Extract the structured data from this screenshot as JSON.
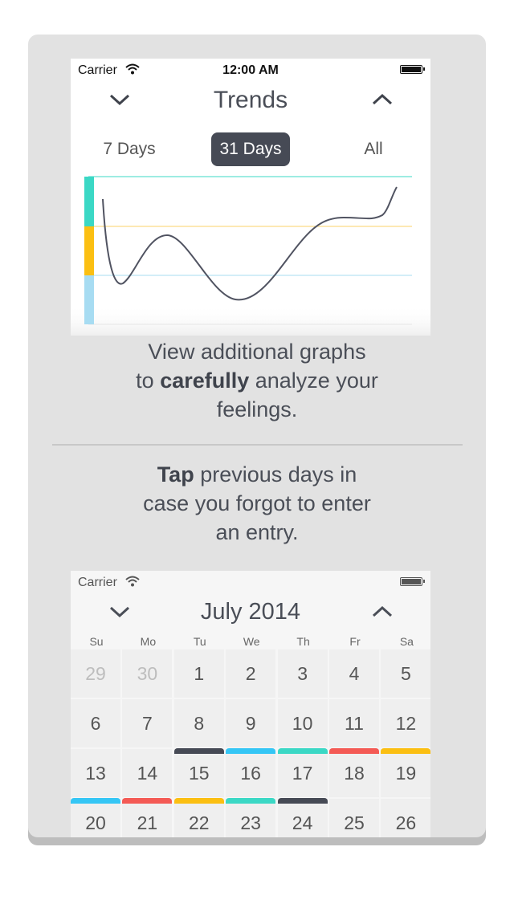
{
  "top": {
    "status": {
      "carrier": "Carrier",
      "time": "12:00 AM"
    },
    "nav_title": "Trends",
    "segments": [
      "7 Days",
      "31 Days",
      "All"
    ],
    "active_segment": 1
  },
  "caption1": {
    "before": "View additional graphs\nto ",
    "bold": "carefully",
    "after": " analyze your feelings."
  },
  "caption2": {
    "bold": "Tap",
    "after": " previous days in case you forgot to enter an entry."
  },
  "calendar": {
    "carrier": "Carrier",
    "title": "July 2014",
    "weekday_labels": [
      "Su",
      "Mo",
      "Tu",
      "We",
      "Th",
      "Fr",
      "Sa"
    ],
    "weeks": [
      [
        "29",
        "30",
        "1",
        "2",
        "3",
        "4",
        "5"
      ],
      [
        "6",
        "7",
        "8",
        "9",
        "10",
        "11",
        "12"
      ],
      [
        "13",
        "14",
        "15",
        "16",
        "17",
        "18",
        "19"
      ],
      [
        "20",
        "21",
        "22",
        "23",
        "24",
        "25",
        "26"
      ]
    ],
    "muted": [
      "29",
      "30"
    ],
    "markers": {
      "15": "#464a55",
      "16": "#35c6f5",
      "17": "#3bd8c5",
      "18": "#f45a55",
      "19": "#fbbf12",
      "20": "#35c6f5",
      "21": "#f45a55",
      "22": "#fbbf12",
      "23": "#3bd8c5",
      "24": "#464a55"
    }
  },
  "colors": {
    "teal": "#3bd8c5",
    "yellow": "#fbbf12",
    "blue": "#a7dcf2",
    "dark": "#464a55"
  }
}
